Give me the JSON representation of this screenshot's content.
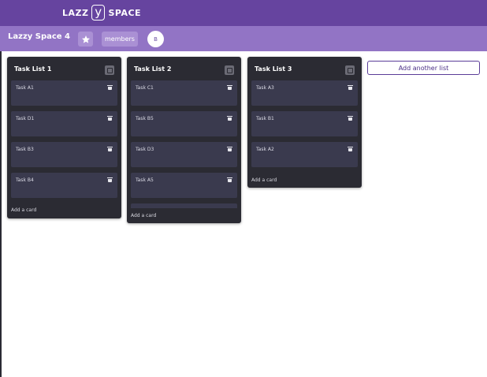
{
  "header": {
    "logo_left": "LAZZ",
    "logo_mark": "y",
    "logo_right": "SPACE"
  },
  "space": {
    "title": "Lazzy Space 4",
    "members_label": "members",
    "avatar_initial": "B",
    "star_icon": "star-icon"
  },
  "lists": [
    {
      "title": "Task List 1",
      "cards": [
        "Task A1",
        "Task D1",
        "Task B3",
        "Task B4"
      ],
      "add_card_label": "Add a card"
    },
    {
      "title": "Task List 2",
      "cards": [
        "Task C1",
        "Task B5",
        "Task D3",
        "Task A5",
        ""
      ],
      "add_card_label": "Add a card"
    },
    {
      "title": "Task List 3",
      "cards": [
        "Task A3",
        "Task B1",
        "Task A2"
      ],
      "add_card_label": "Add a card"
    }
  ],
  "add_list_label": "Add another list",
  "colors": {
    "topbar": "#66449f",
    "subbar": "#9274c5",
    "list_bg": "#2b2b33",
    "card_bg": "#3a3a4e",
    "accent": "#5b3d98"
  }
}
